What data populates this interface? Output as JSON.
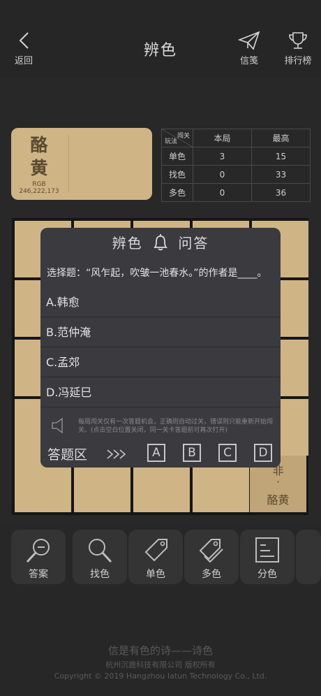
{
  "header": {
    "back_label": "返回",
    "title": "辨色",
    "send_label": "信笺",
    "rank_label": "排行榜"
  },
  "swatch": {
    "name_line1": "酪",
    "name_line2": "黄",
    "rgb_label": "RGB",
    "rgb_value": "246,222,173",
    "color": "#cfb486"
  },
  "scores": {
    "corner_top": "闯关",
    "corner_bottom": "玩法",
    "col_current": "本局",
    "col_best": "最高",
    "rows": [
      {
        "mode": "单色",
        "current": "3",
        "best": "15"
      },
      {
        "mode": "找色",
        "current": "0",
        "best": "33"
      },
      {
        "mode": "多色",
        "current": "0",
        "best": "36"
      }
    ]
  },
  "board": {
    "highlight_text_1": "非",
    "highlight_text_2": "·",
    "highlight_text_3": "酪黄"
  },
  "quiz": {
    "title_left": "辨色",
    "title_right": "问答",
    "question": "选择题：“风乍起，吹皱一池春水。”的作者是____。",
    "options": [
      "A.韩愈",
      "B.范仲淹",
      "C.孟郊",
      "D.冯延巳"
    ],
    "tip": "每局闯关仅有一次答题机会，正确则自动过关，错误则只能重新开始闯关。(点击空白位置关闭，同一关卡答题前可再次打开)",
    "answer_area_label": "答题区",
    "keys": [
      "A",
      "B",
      "C",
      "D"
    ]
  },
  "tools": [
    {
      "label": "答案",
      "icon": "zoom-out-icon"
    },
    {
      "label": "找色",
      "icon": "search-icon"
    },
    {
      "label": "单色",
      "icon": "tag-icon"
    },
    {
      "label": "多色",
      "icon": "tags-icon"
    },
    {
      "label": "分色",
      "icon": "list-card-icon"
    }
  ],
  "footer": {
    "slogan": "信是有色的诗——诗色",
    "company": "杭州沉鹿科技有限公司 版权所有",
    "copyright": "Copyright © 2019 Hangzhou Iatun Technology Co., Ltd."
  }
}
